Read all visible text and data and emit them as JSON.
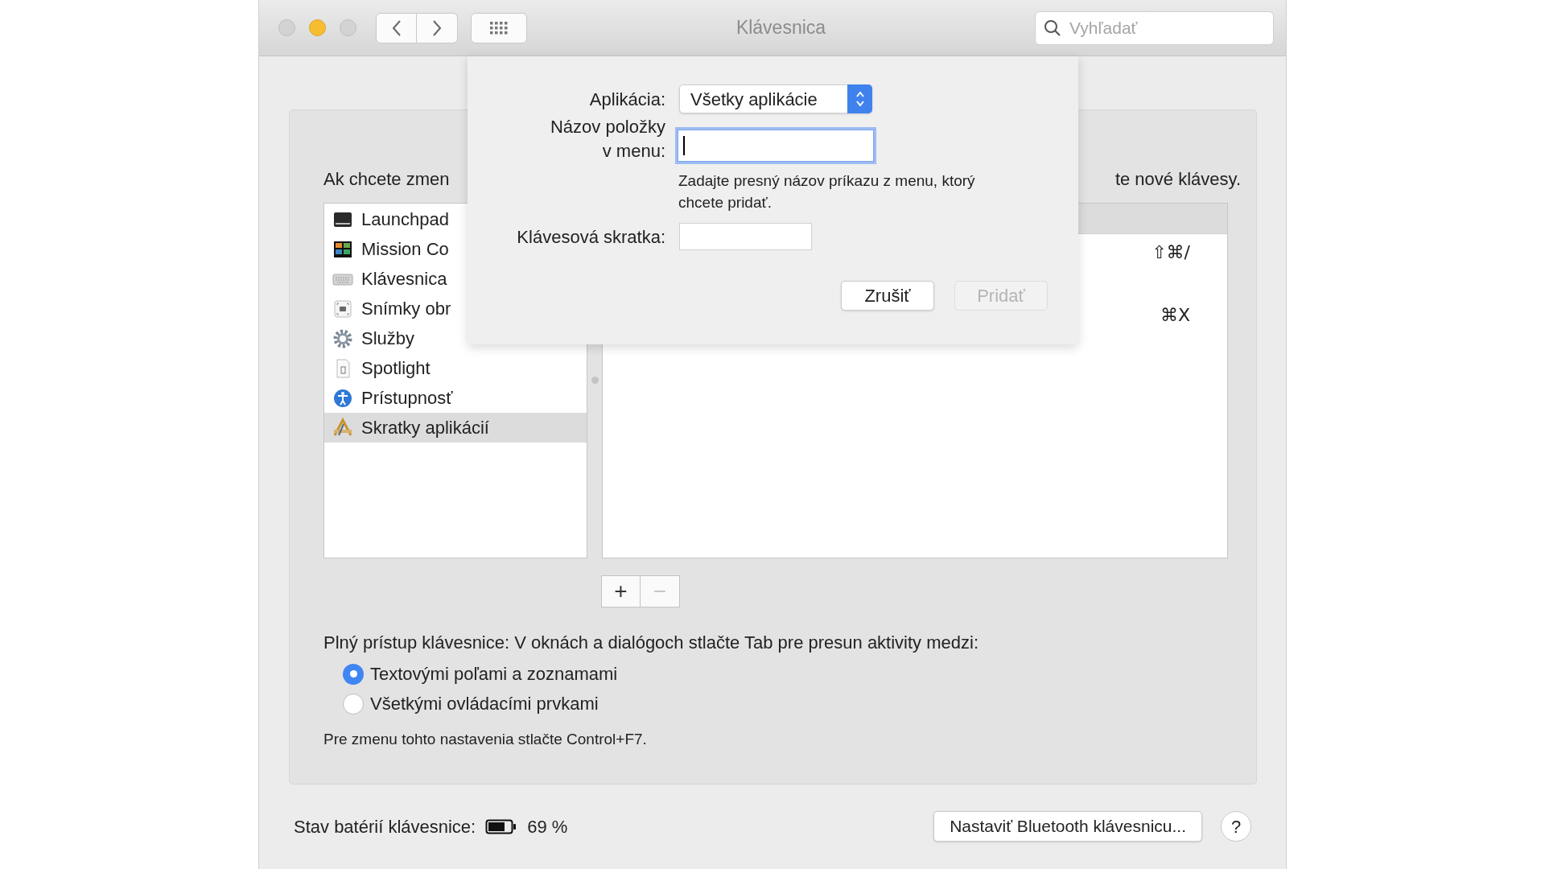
{
  "window": {
    "title": "Klávesnica",
    "search": {
      "placeholder": "Vyhľadať"
    }
  },
  "panel": {
    "instruction_left": "Ak chcete zmen",
    "instruction_right": "te nové klávesy.",
    "categories": [
      {
        "label": "Launchpad",
        "selected": false
      },
      {
        "label": "Mission Co",
        "selected": false
      },
      {
        "label": "Klávesnica",
        "selected": false
      },
      {
        "label": "Snímky obr",
        "selected": false
      },
      {
        "label": "Služby",
        "selected": false
      },
      {
        "label": "Spotlight",
        "selected": false
      },
      {
        "label": "Prístupnosť",
        "selected": false
      },
      {
        "label": "Skratky aplikácií",
        "selected": true
      }
    ],
    "shortcuts": [
      {
        "keys": "⇧⌘/"
      },
      {
        "keys": "⌘X"
      }
    ],
    "list_buttons": [
      {
        "label": "+",
        "disabled": false
      },
      {
        "label": "−",
        "disabled": true
      }
    ],
    "full_access_label": "Plný prístup klávesnice: V oknách a dialógoch stlačte Tab pre presun aktivity medzi:",
    "radios": [
      {
        "label": "Textovými poľami a zoznamami",
        "selected": true
      },
      {
        "label": "Všetkými ovládacími prvkami",
        "selected": false
      }
    ],
    "note": "Pre zmenu tohto nastavenia stlačte Control+F7."
  },
  "battery": {
    "label": "Stav batérií klávesnice:",
    "reading": "69 %"
  },
  "bluetooth_button": "Nastaviť Bluetooth klávesnicu...",
  "help_button": "?",
  "sheet": {
    "app_label": "Aplikácia:",
    "app_value": "Všetky aplikácie",
    "menu_label_lines": [
      "Názov položky",
      "v menu:"
    ],
    "menu_field": {
      "focused": true
    },
    "hint": "Zadajte presný názov príkazu z menu, ktorý chcete pridať.",
    "shortcut_label": "Klávesová skratka:",
    "buttons": [
      {
        "label": "Zrušiť",
        "disabled": false
      },
      {
        "label": "Pridať",
        "disabled": true
      }
    ]
  }
}
